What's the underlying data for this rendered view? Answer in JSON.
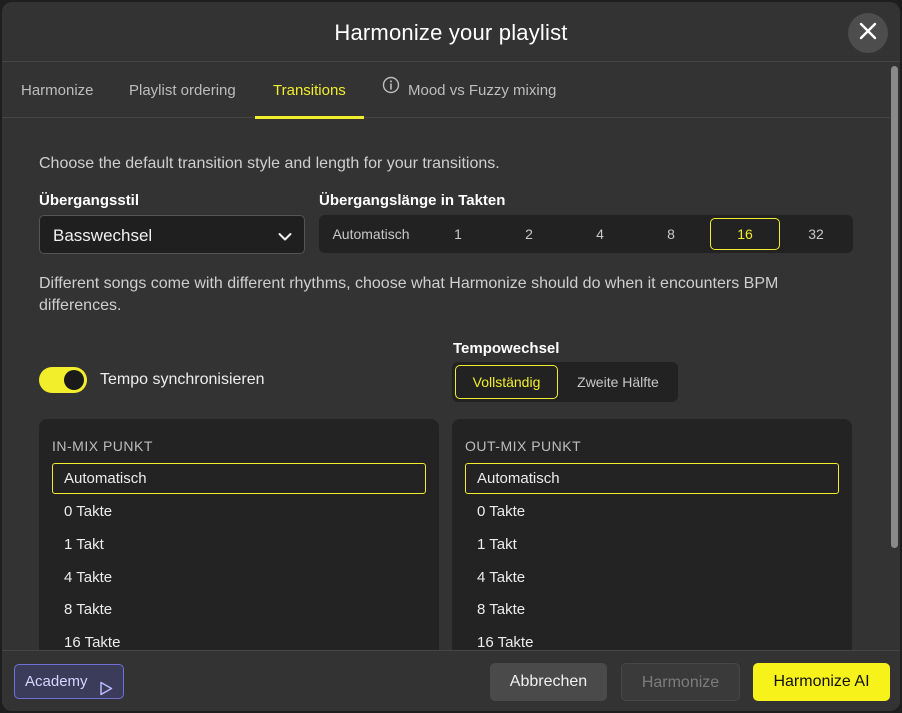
{
  "dialog": {
    "title": "Harmonize your playlist"
  },
  "tabs": [
    {
      "label": "Harmonize",
      "icon": ""
    },
    {
      "label": "Playlist ordering",
      "icon": ""
    },
    {
      "label": "Transitions",
      "icon": ""
    },
    {
      "label": "Mood vs Fuzzy mixing",
      "icon": "info-icon"
    }
  ],
  "active_tab": "Transitions",
  "intro_text": "Choose the default transition style and length for your transitions.",
  "transition_style": {
    "label": "Übergangsstil",
    "value": "Basswechsel"
  },
  "transition_length": {
    "label": "Übergangslänge in Takten",
    "options": [
      "Automatisch",
      "1",
      "2",
      "4",
      "8",
      "16",
      "32"
    ],
    "selected": "16"
  },
  "bpm_text": "Different songs come with different rhythms, choose what Harmonize should do when it encounters BPM differences.",
  "tempo_sync": {
    "label": "Tempo synchronisieren",
    "enabled": true
  },
  "tempo_change": {
    "label": "Tempowechsel",
    "options": [
      "Vollständig",
      "Zweite Hälfte"
    ],
    "selected": "Vollständig"
  },
  "in_mix": {
    "title": "IN-MIX PUNKT",
    "items": [
      "Automatisch",
      "0 Takte",
      "1 Takt",
      "4 Takte",
      "8 Takte",
      "16 Takte"
    ],
    "selected": "Automatisch"
  },
  "out_mix": {
    "title": "OUT-MIX PUNKT",
    "items": [
      "Automatisch",
      "0 Takte",
      "1 Takt",
      "4 Takte",
      "8 Takte",
      "16 Takte"
    ],
    "selected": "Automatisch"
  },
  "footer": {
    "academy_label": "Academy",
    "cancel_label": "Abbrechen",
    "harmonize_label": "Harmonize",
    "harmonize_ai_label": "Harmonize AI"
  },
  "colors": {
    "accent": "#f2ee2b",
    "background": "#333333",
    "panel": "#232323",
    "academy": "#6e72d8"
  }
}
